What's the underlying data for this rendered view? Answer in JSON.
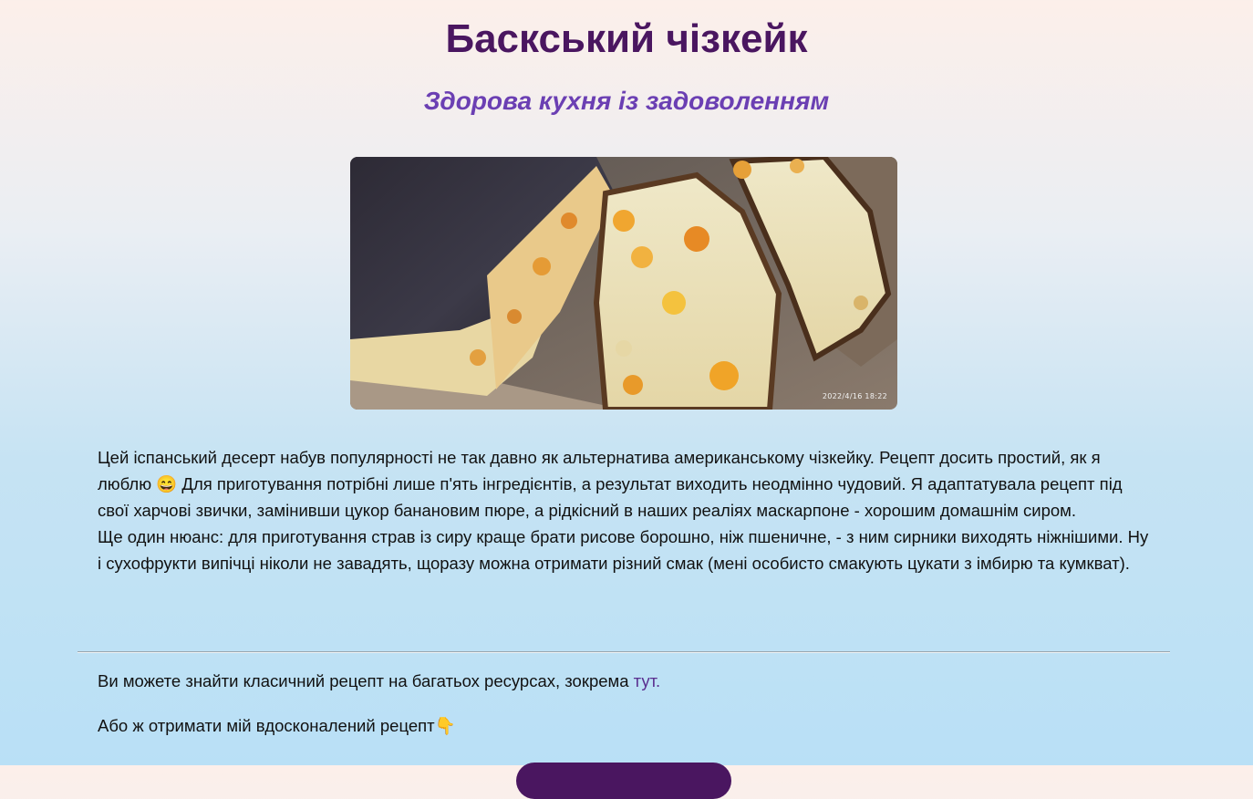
{
  "page": {
    "title": "Баскський чізкейк",
    "subtitle": "Здорова кухня із задоволенням"
  },
  "photo": {
    "timestamp": "2022/4/16 18:22"
  },
  "description": {
    "paragraph1": "Цей іспанський десерт набув популярності не так давно як альтернатива американському чізкейку. Рецепт досить простий, як я люблю 😄 Для приготування потрібні лише п'ять інгредієнтів, а результат виходить неодмінно чудовий. Я адаптатувала рецепт під свої харчові звички, замінивши цукор банановим пюре, а рідкісний в наших реаліях маскарпоне - хорошим домашнім сиром.",
    "paragraph2": "Ще один нюанс: для приготування страв із сиру краще брати рисове борошно, ніж пшеничне, - з ним сирники виходять ніжнішими. Ну і сухофрукти випічці ніколи не завадять, щоразу можна отримати різний смак (мені особисто смакують цукати з імбирю та кумкват)."
  },
  "links": {
    "classic_text": "Ви можете знайти класичний рецепт на багатьох ресурсах, зокрема ",
    "classic_link": "тут.",
    "improved_text": "Або ж отримати мій вдосконалений рецепт👇"
  },
  "colors": {
    "title": "#4a1660",
    "subtitle": "#6b3fb3",
    "link": "#5a2f8f",
    "button": "#4a1660"
  }
}
